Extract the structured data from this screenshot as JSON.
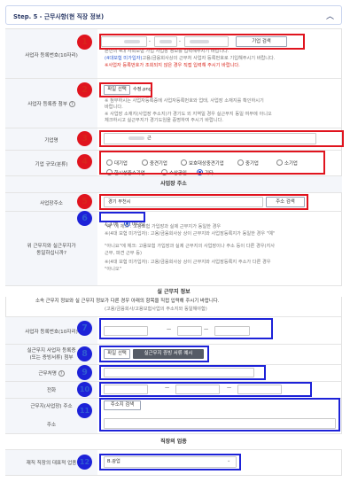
{
  "header": {
    "title": "Step. 5 - 근무사항(현 직장 정보)"
  },
  "rows": {
    "biz_reg_no": {
      "label": "사업자 등록번호(10자리)",
      "dash1": "-",
      "dash2": "-",
      "search_btn": "기업 검색",
      "note1": "본인의 4대 사회보험 가입 사업장 정보를 입력해주시기 바랍니다.",
      "note2_prefix": "(4대보험 미가입자)",
      "note2_rest": "고용/금융회사상의 근무처 사업자 등록번호로 기입해주시기 바랍니다.",
      "note3": "※사업자 등록번호가 조회되지 않은 경우 직접 입력해 주시기 바랍니다."
    },
    "biz_reg_cert": {
      "label": "사업자 등록증 첨부",
      "file_btn": "파일 선택",
      "file_name": "수정.png",
      "note1": "※ 첨부하시는 사업자등록증에 사업자등록번호와 업태, 사업장 소재지를 확인하시기",
      "note1b": "바랍니다.",
      "note2": "※ 사업장 소재지(사업장 주소지)가 경기도 외 지역일 경우 실근무지 동일 여부에 아니오",
      "note2b": "체크하시고 실근무지가 경기도임을 증명하여 주시기 바랍니다."
    },
    "company_name": {
      "label": "기업명",
      "value_suffix": "근"
    },
    "company_size": {
      "label": "기업 규모(분류)",
      "options": [
        "대기업",
        "중견기업",
        "보호대상중견기업",
        "중기업",
        "소기업",
        "한시성중소기업",
        "소상공인",
        "기타"
      ],
      "selected": "기타"
    }
  },
  "section_address": {
    "title": "사업장 주소",
    "address_label": "사업장주소",
    "address_value": "경기 부천시",
    "address_btn": "주소 검색",
    "same_label_1": "위 근무지와 실근무지가",
    "same_label_2": "동일하십니까?",
    "yes": "예",
    "no": "아니오",
    "selected": "아니오",
    "note1": "\"예\" 에 체크 : 고용보험 가입장과 실제 근무지가 동일한 경우",
    "note2": "※(4대 보험 미가입자): 고용/금융회사상 상이 근무지와 사업장등록지가 동일한 경우 \"예\"",
    "note3": "\"아니요\"에 체크: 고용보험 가입장과 실제 근무지의 사업장이나 주소 등이 다른 경우(지사",
    "note3b": "근무, 파견 근무 등)",
    "note4": "※(4대 보험 미가입자): 고용/금융회사상 상이 근무지와 사업장등록지 주소가 다른 경우",
    "note4b": "\"아니오\""
  },
  "section_actual": {
    "title": "실 근무지 정보",
    "desc1": "소속 근무지 정보와 실 근무지 정보가 다른 경우 아래의 항목을 직접 입력해 주시기 바랍니다.",
    "desc2": "(고용/금융회사/고용보험사업의 주소지와 동일해야함)",
    "reg_no_label": "사업자 등록번호(10자리)",
    "cert_label_1": "실근무지 사업자 등록증",
    "cert_label_2": "(또는 증빙서류) 첨부",
    "file_btn": "파일 선택",
    "example_btn": "실근무지 증빙 서류 예시",
    "site_name_label": "근무처명",
    "phone_label": "전화",
    "address_label": "근무지(사업장) 주소",
    "address_btn": "주소지 검색",
    "detail_label": "주소"
  },
  "section_job": {
    "title": "직장의 업종",
    "label": "재직 직장의 대표적 업종",
    "value": "B.광업"
  },
  "markers": [
    "1",
    "2",
    "3",
    "4",
    "5",
    "6",
    "7",
    "8",
    "9",
    "10",
    "11",
    "12"
  ]
}
